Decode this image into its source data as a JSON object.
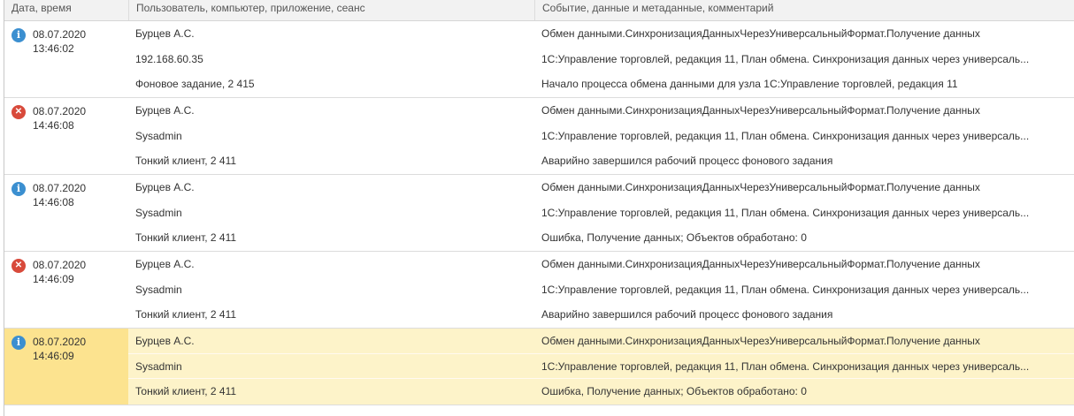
{
  "columns": {
    "datetime": "Дата, время",
    "user": "Пользователь, компьютер, приложение, сеанс",
    "event": "Событие, данные и метаданные, комментарий"
  },
  "rows": [
    {
      "level": "info",
      "date": "08.07.2020",
      "time": "13:46:02",
      "user": "Бурцев А.С.",
      "computer": "192.168.60.35",
      "application": "Фоновое задание, 2 415",
      "event": "Обмен данными.СинхронизацияДанныхЧерезУниверсальныйФормат.Получение данных",
      "metadata": "1С:Управление торговлей, редакция 11, План обмена. Синхронизация данных через универсаль...",
      "comment": "Начало процесса обмена данными для узла 1С:Управление торговлей, редакция 11",
      "selected": false
    },
    {
      "level": "error",
      "date": "08.07.2020",
      "time": "14:46:08",
      "user": "Бурцев А.С.",
      "computer": "Sysadmin",
      "application": "Тонкий клиент, 2 411",
      "event": "Обмен данными.СинхронизацияДанныхЧерезУниверсальныйФормат.Получение данных",
      "metadata": "1С:Управление торговлей, редакция 11, План обмена. Синхронизация данных через универсаль...",
      "comment": "Аварийно завершился рабочий процесс фонового задания",
      "selected": false
    },
    {
      "level": "info",
      "date": "08.07.2020",
      "time": "14:46:08",
      "user": "Бурцев А.С.",
      "computer": "Sysadmin",
      "application": "Тонкий клиент, 2 411",
      "event": "Обмен данными.СинхронизацияДанныхЧерезУниверсальныйФормат.Получение данных",
      "metadata": "1С:Управление торговлей, редакция 11, План обмена. Синхронизация данных через универсаль...",
      "comment": "Ошибка, Получение данных; Объектов обработано: 0",
      "selected": false
    },
    {
      "level": "error",
      "date": "08.07.2020",
      "time": "14:46:09",
      "user": "Бурцев А.С.",
      "computer": "Sysadmin",
      "application": "Тонкий клиент, 2 411",
      "event": "Обмен данными.СинхронизацияДанныхЧерезУниверсальныйФормат.Получение данных",
      "metadata": "1С:Управление торговлей, редакция 11, План обмена. Синхронизация данных через универсаль...",
      "comment": "Аварийно завершился рабочий процесс фонового задания",
      "selected": false
    },
    {
      "level": "info",
      "date": "08.07.2020",
      "time": "14:46:09",
      "user": "Бурцев А.С.",
      "computer": "Sysadmin",
      "application": "Тонкий клиент, 2 411",
      "event": "Обмен данными.СинхронизацияДанныхЧерезУниверсальныйФормат.Получение данных",
      "metadata": "1С:Управление торговлей, редакция 11, План обмена. Синхронизация данных через универсаль...",
      "comment": "Ошибка, Получение данных; Объектов обработано: 0",
      "selected": true
    }
  ],
  "icons": {
    "info": {
      "name": "info-icon",
      "glyph": "i",
      "color": "#3b8fd0"
    },
    "error": {
      "name": "error-icon",
      "glyph": "✕",
      "color": "#d84a3b"
    }
  },
  "colors": {
    "selected_row": "#fdf3c9",
    "selected_cell": "#fce38f",
    "header_bg": "#f2f2f2"
  }
}
